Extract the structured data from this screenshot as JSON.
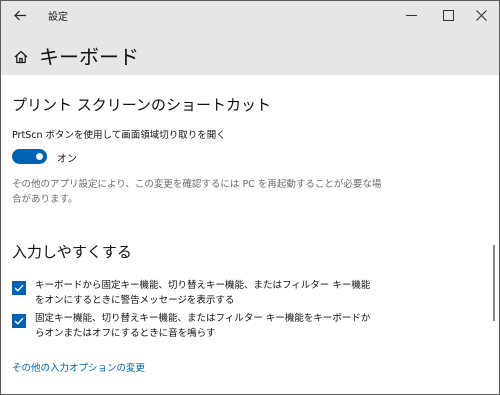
{
  "window": {
    "app_title": "設定",
    "back_icon": "arrow-left-icon",
    "controls": [
      "minimize-icon",
      "maximize-icon",
      "close-icon"
    ]
  },
  "header": {
    "home_icon": "home-icon",
    "page_title": "キーボード"
  },
  "print_screen": {
    "heading": "プリント スクリーンのショートカット",
    "setting_label": "PrtScn ボタンを使用して画面領域切り取りを開く",
    "toggle_state": "オン",
    "toggle_on": true,
    "note": "その他のアプリ設定により、この変更を確認するには PC を再起動することが必要な場合があります。"
  },
  "ease_of_input": {
    "heading": "入力しやすくする",
    "checkboxes": [
      {
        "label": "キーボードから固定キー機能、切り替えキー機能、またはフィルター キー機能をオンにするときに警告メッセージを表示する",
        "checked": true
      },
      {
        "label": "固定キー機能、切り替えキー機能、またはフィルター キー機能をキーボードからオンまたはオフにするときに音を鳴らす",
        "checked": true
      }
    ],
    "link": "その他の入力オプションの変更"
  },
  "colors": {
    "accent": "#0063b1",
    "header_bg": "#e6e6e6",
    "note_text": "#6b6b6b"
  }
}
